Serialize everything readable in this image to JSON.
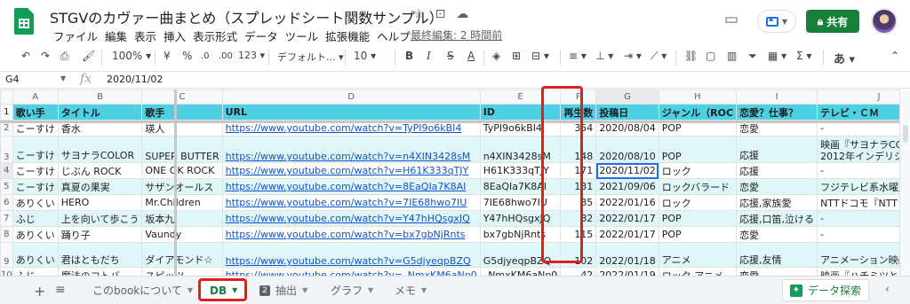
{
  "app": {
    "title": "STGVのカヴァー曲まとめ（スプレッドシート関数サンプル）",
    "last_edit": "最終編集: 2 時間前",
    "share_label": "共有",
    "menu": [
      "ファイル",
      "編集",
      "表示",
      "挿入",
      "表示形式",
      "データ",
      "ツール",
      "拡張機能",
      "ヘルプ"
    ]
  },
  "toolbar": {
    "zoom": "100%",
    "currency": "¥",
    "percent": "%",
    "dec_less": ".0",
    "dec_more": ".00",
    "format_more": "123",
    "font": "デフォルト...",
    "font_size": "10",
    "bold": "B",
    "italic": "I",
    "strike": "S",
    "text_color": "A",
    "input_tools": "あ"
  },
  "formula_bar": {
    "cell_ref": "G4",
    "fx": "fx",
    "value": "2020/11/02"
  },
  "grid": {
    "columns": [
      "A",
      "B",
      "C",
      "D",
      "E",
      "F",
      "G",
      "H",
      "I",
      "J"
    ],
    "header_row": [
      "歌い手",
      "タイトル",
      "歌手",
      "URL",
      "ID",
      "再生数",
      "投稿日",
      "ジャンル（ROC",
      "恋愛？仕事？",
      "テレビ・ＣＭ"
    ],
    "rows": [
      {
        "n": "2",
        "cells": [
          "こーすけ",
          "香水",
          "瑛人",
          "https://www.youtube.com/watch?v=TyPI9o6kBI4",
          "TyPI9o6kBI4",
          "354",
          "2020/08/04",
          "POP",
          "恋愛",
          "-"
        ]
      },
      {
        "n": "3",
        "cells": [
          "こーすけ",
          "サヨナラCOLOR",
          "SUPER BUTTER",
          "https://www.youtube.com/watch?v=n4XIN3428sM",
          "n4XIN3428sM",
          "148",
          "2020/08/10",
          "POP",
          "応援",
          "映画『サヨナラCOLOR』"
        ],
        "extra": "2012年インデリジェンス"
      },
      {
        "n": "4",
        "cells": [
          "こーすけ",
          "じぶん ROCK",
          "ONE OK ROCK",
          "https://www.youtube.com/watch?v=H61K333qTJY",
          "H61K333qTJY",
          "171",
          "2020/11/02",
          "ロック",
          "応援",
          "-"
        ]
      },
      {
        "n": "5",
        "cells": [
          "こーすけ",
          "真夏の果実",
          "サザンオールス",
          "https://www.youtube.com/watch?v=8EaQIa7K8AI",
          "8EaQIa7K8AI",
          "131",
          "2021/09/06",
          "ロックバラード",
          "恋愛",
          "フジテレビ系水曜劇場『"
        ]
      },
      {
        "n": "6",
        "cells": [
          "ありくい",
          "HERO",
          "Mr.Children",
          "https://www.youtube.com/watch?v=7IE68hwo7IU",
          "7IE68hwo7IU",
          "85",
          "2022/01/16",
          "ロック",
          "応援,家族愛",
          "NTTドコモ『NTT DoCoM"
        ]
      },
      {
        "n": "7",
        "cells": [
          "ふじ",
          "上を向いて歩こう",
          "坂本九",
          "https://www.youtube.com/watch?v=Y47hHQsgxJQ",
          "Y47hHQsgxJQ",
          "82",
          "2022/01/17",
          "POP",
          "応援,口笛,泣ける",
          "-"
        ]
      },
      {
        "n": "8",
        "cells": [
          "ありくい",
          "踊り子",
          "Vaundy",
          "https://www.youtube.com/watch?v=bx7gbNjRnts",
          "bx7gbNjRnts",
          "115",
          "2022/01/17",
          "POP",
          "恋愛",
          "-"
        ]
      },
      {
        "n": "9",
        "cells": [
          "ありくい",
          "君はともだち",
          "ダイアモンド☆",
          "https://www.youtube.com/watch?v=G5djyeqpBZQ",
          "G5djyeqpBZQ",
          "102",
          "2022/01/18",
          "アニメ",
          "応援,友情",
          "アニメーション映画『トイ"
        ],
        "extra": "【英】You've Go"
      },
      {
        "n": "10",
        "cells": [
          "ふじ",
          "魔法のコトバ",
          "スピッツ",
          "https://www.youtube.com/watch?v=_NmxKM6aNp0",
          "_NmxKM6aNp0",
          "42",
          "2022/01/19",
          "ロック,アニメ",
          "恋愛",
          "映画『ハチミツとクローバ"
        ]
      }
    ]
  },
  "tabs": {
    "sheets": [
      "このbookについて",
      "DB",
      "抽出",
      "グラフ",
      "メモ"
    ],
    "sheet2_icon": "2",
    "explore_label": "データ探索"
  },
  "colors": {
    "header_fill": "#4dd0e1",
    "alt_fill": "#e0f7fa",
    "highlight": "#e02020",
    "accent_green": "#188038"
  }
}
